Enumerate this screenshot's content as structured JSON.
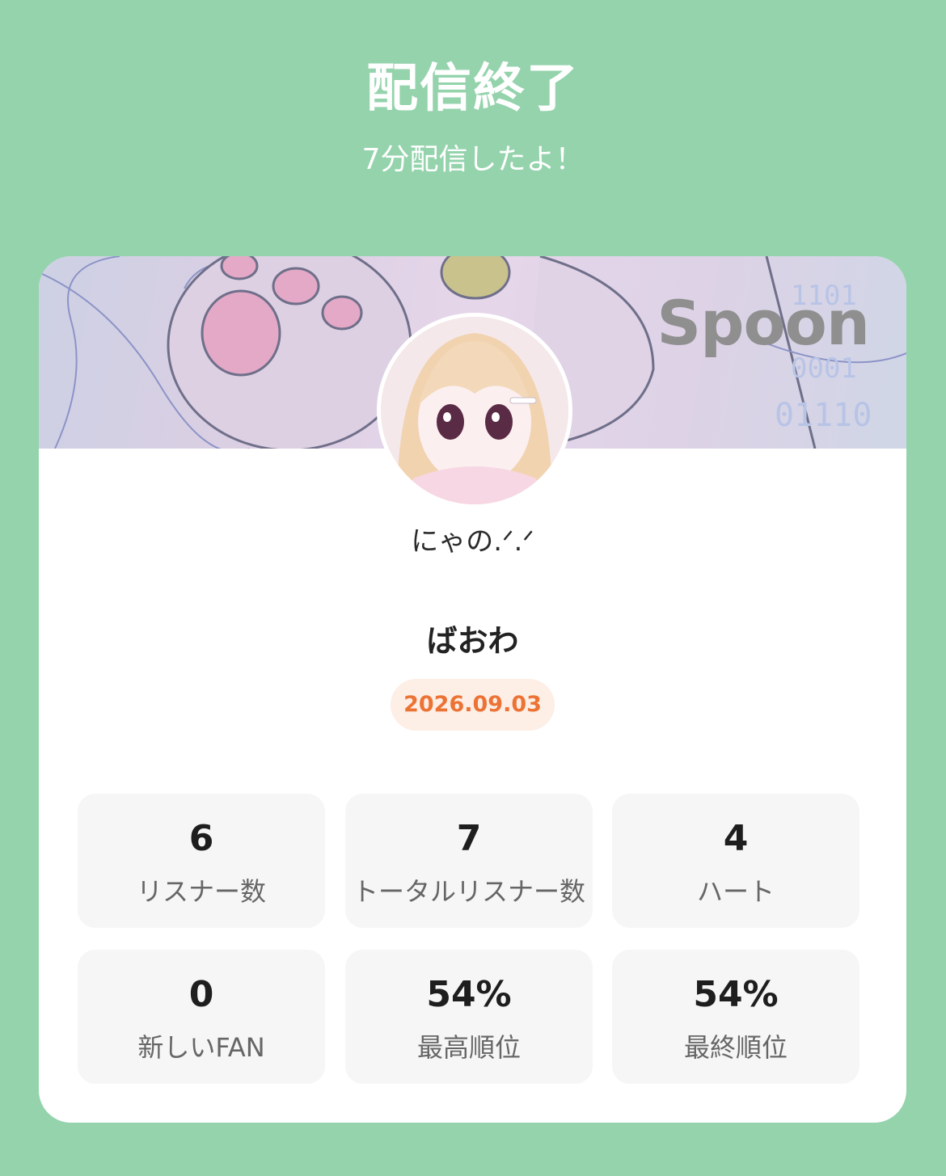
{
  "header": {
    "title": "配信終了",
    "subtitle": "7分配信したよ！"
  },
  "card": {
    "brand": "Spoon",
    "username": "にゃの.ᐟ.ᐟ",
    "stream_title": "ばおわ",
    "date": "2026.09.03",
    "stats": [
      {
        "value": "6",
        "label": "リスナー数"
      },
      {
        "value": "7",
        "label": "トータルリスナー数"
      },
      {
        "value": "4",
        "label": "ハート"
      },
      {
        "value": "0",
        "label": "新しいFAN"
      },
      {
        "value": "54%",
        "label": "最高順位"
      },
      {
        "value": "54%",
        "label": "最終順位"
      }
    ]
  },
  "colors": {
    "background": "#94d3ac",
    "date_text": "#ec7334",
    "date_badge": "#fdeee6"
  }
}
